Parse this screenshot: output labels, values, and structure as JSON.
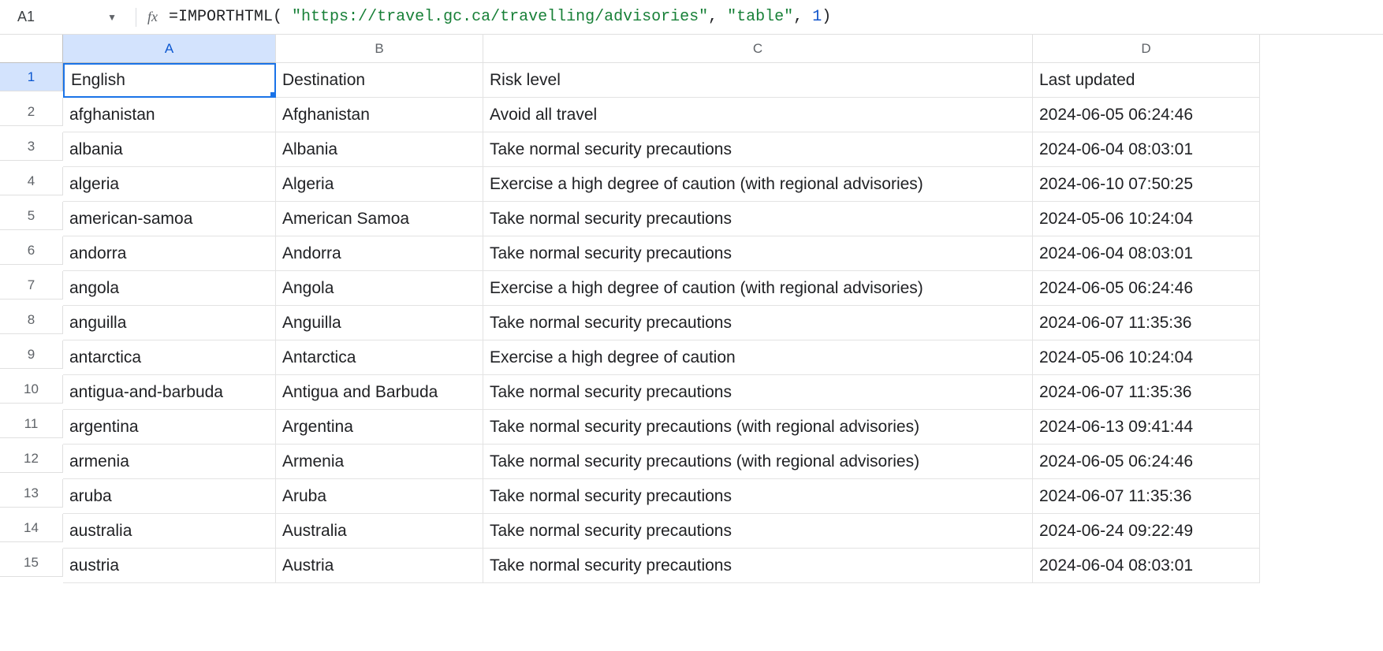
{
  "name_box": "A1",
  "formula": {
    "prefix": "=IMPORTHTML(",
    "space1": " ",
    "arg1": "\"https://travel.gc.ca/travelling/advisories\"",
    "comma1": ",",
    "space2": " ",
    "arg2": "\"table\"",
    "comma2": ",",
    "space3": " ",
    "arg3": "1",
    "suffix": ")"
  },
  "columns": [
    "A",
    "B",
    "C",
    "D"
  ],
  "rows": [
    {
      "n": "1",
      "a": "English",
      "b": "Destination",
      "c": "Risk level",
      "d": "Last updated"
    },
    {
      "n": "2",
      "a": "afghanistan",
      "b": "Afghanistan",
      "c": "Avoid all travel",
      "d": "2024-06-05 06:24:46"
    },
    {
      "n": "3",
      "a": "albania",
      "b": "Albania",
      "c": "Take normal security precautions",
      "d": "2024-06-04 08:03:01"
    },
    {
      "n": "4",
      "a": "algeria",
      "b": "Algeria",
      "c": "Exercise a high degree of caution (with regional advisories)",
      "d": "2024-06-10 07:50:25"
    },
    {
      "n": "5",
      "a": "american-samoa",
      "b": "American Samoa",
      "c": "Take normal security precautions",
      "d": "2024-05-06 10:24:04"
    },
    {
      "n": "6",
      "a": "andorra",
      "b": "Andorra",
      "c": "Take normal security precautions",
      "d": "2024-06-04 08:03:01"
    },
    {
      "n": "7",
      "a": "angola",
      "b": "Angola",
      "c": "Exercise a high degree of caution (with regional advisories)",
      "d": "2024-06-05 06:24:46"
    },
    {
      "n": "8",
      "a": "anguilla",
      "b": "Anguilla",
      "c": "Take normal security precautions",
      "d": "2024-06-07 11:35:36"
    },
    {
      "n": "9",
      "a": "antarctica",
      "b": "Antarctica",
      "c": "Exercise a high degree of caution",
      "d": "2024-05-06 10:24:04"
    },
    {
      "n": "10",
      "a": "antigua-and-barbuda",
      "b": "Antigua and Barbuda",
      "c": "Take normal security precautions",
      "d": "2024-06-07 11:35:36"
    },
    {
      "n": "11",
      "a": "argentina",
      "b": "Argentina",
      "c": "Take normal security precautions (with regional advisories)",
      "d": "2024-06-13 09:41:44"
    },
    {
      "n": "12",
      "a": "armenia",
      "b": "Armenia",
      "c": "Take normal security precautions (with regional advisories)",
      "d": "2024-06-05 06:24:46"
    },
    {
      "n": "13",
      "a": "aruba",
      "b": "Aruba",
      "c": "Take normal security precautions",
      "d": "2024-06-07 11:35:36"
    },
    {
      "n": "14",
      "a": "australia",
      "b": "Australia",
      "c": "Take normal security precautions",
      "d": "2024-06-24 09:22:49"
    },
    {
      "n": "15",
      "a": "austria",
      "b": "Austria",
      "c": "Take normal security precautions",
      "d": "2024-06-04 08:03:01"
    }
  ],
  "selected_cell": "A1",
  "active_col_index": 0,
  "active_row_index": 0
}
